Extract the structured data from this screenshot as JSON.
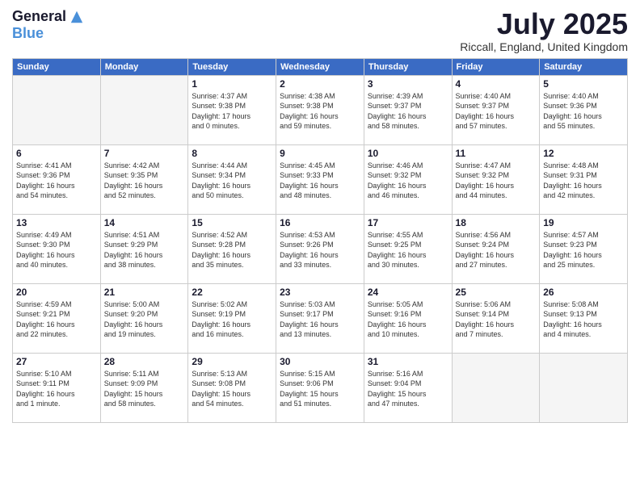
{
  "logo": {
    "general": "General",
    "blue": "Blue"
  },
  "header": {
    "title": "July 2025",
    "location": "Riccall, England, United Kingdom"
  },
  "weekdays": [
    "Sunday",
    "Monday",
    "Tuesday",
    "Wednesday",
    "Thursday",
    "Friday",
    "Saturday"
  ],
  "weeks": [
    [
      {
        "day": "",
        "info": ""
      },
      {
        "day": "",
        "info": ""
      },
      {
        "day": "1",
        "info": "Sunrise: 4:37 AM\nSunset: 9:38 PM\nDaylight: 17 hours\nand 0 minutes."
      },
      {
        "day": "2",
        "info": "Sunrise: 4:38 AM\nSunset: 9:38 PM\nDaylight: 16 hours\nand 59 minutes."
      },
      {
        "day": "3",
        "info": "Sunrise: 4:39 AM\nSunset: 9:37 PM\nDaylight: 16 hours\nand 58 minutes."
      },
      {
        "day": "4",
        "info": "Sunrise: 4:40 AM\nSunset: 9:37 PM\nDaylight: 16 hours\nand 57 minutes."
      },
      {
        "day": "5",
        "info": "Sunrise: 4:40 AM\nSunset: 9:36 PM\nDaylight: 16 hours\nand 55 minutes."
      }
    ],
    [
      {
        "day": "6",
        "info": "Sunrise: 4:41 AM\nSunset: 9:36 PM\nDaylight: 16 hours\nand 54 minutes."
      },
      {
        "day": "7",
        "info": "Sunrise: 4:42 AM\nSunset: 9:35 PM\nDaylight: 16 hours\nand 52 minutes."
      },
      {
        "day": "8",
        "info": "Sunrise: 4:44 AM\nSunset: 9:34 PM\nDaylight: 16 hours\nand 50 minutes."
      },
      {
        "day": "9",
        "info": "Sunrise: 4:45 AM\nSunset: 9:33 PM\nDaylight: 16 hours\nand 48 minutes."
      },
      {
        "day": "10",
        "info": "Sunrise: 4:46 AM\nSunset: 9:32 PM\nDaylight: 16 hours\nand 46 minutes."
      },
      {
        "day": "11",
        "info": "Sunrise: 4:47 AM\nSunset: 9:32 PM\nDaylight: 16 hours\nand 44 minutes."
      },
      {
        "day": "12",
        "info": "Sunrise: 4:48 AM\nSunset: 9:31 PM\nDaylight: 16 hours\nand 42 minutes."
      }
    ],
    [
      {
        "day": "13",
        "info": "Sunrise: 4:49 AM\nSunset: 9:30 PM\nDaylight: 16 hours\nand 40 minutes."
      },
      {
        "day": "14",
        "info": "Sunrise: 4:51 AM\nSunset: 9:29 PM\nDaylight: 16 hours\nand 38 minutes."
      },
      {
        "day": "15",
        "info": "Sunrise: 4:52 AM\nSunset: 9:28 PM\nDaylight: 16 hours\nand 35 minutes."
      },
      {
        "day": "16",
        "info": "Sunrise: 4:53 AM\nSunset: 9:26 PM\nDaylight: 16 hours\nand 33 minutes."
      },
      {
        "day": "17",
        "info": "Sunrise: 4:55 AM\nSunset: 9:25 PM\nDaylight: 16 hours\nand 30 minutes."
      },
      {
        "day": "18",
        "info": "Sunrise: 4:56 AM\nSunset: 9:24 PM\nDaylight: 16 hours\nand 27 minutes."
      },
      {
        "day": "19",
        "info": "Sunrise: 4:57 AM\nSunset: 9:23 PM\nDaylight: 16 hours\nand 25 minutes."
      }
    ],
    [
      {
        "day": "20",
        "info": "Sunrise: 4:59 AM\nSunset: 9:21 PM\nDaylight: 16 hours\nand 22 minutes."
      },
      {
        "day": "21",
        "info": "Sunrise: 5:00 AM\nSunset: 9:20 PM\nDaylight: 16 hours\nand 19 minutes."
      },
      {
        "day": "22",
        "info": "Sunrise: 5:02 AM\nSunset: 9:19 PM\nDaylight: 16 hours\nand 16 minutes."
      },
      {
        "day": "23",
        "info": "Sunrise: 5:03 AM\nSunset: 9:17 PM\nDaylight: 16 hours\nand 13 minutes."
      },
      {
        "day": "24",
        "info": "Sunrise: 5:05 AM\nSunset: 9:16 PM\nDaylight: 16 hours\nand 10 minutes."
      },
      {
        "day": "25",
        "info": "Sunrise: 5:06 AM\nSunset: 9:14 PM\nDaylight: 16 hours\nand 7 minutes."
      },
      {
        "day": "26",
        "info": "Sunrise: 5:08 AM\nSunset: 9:13 PM\nDaylight: 16 hours\nand 4 minutes."
      }
    ],
    [
      {
        "day": "27",
        "info": "Sunrise: 5:10 AM\nSunset: 9:11 PM\nDaylight: 16 hours\nand 1 minute."
      },
      {
        "day": "28",
        "info": "Sunrise: 5:11 AM\nSunset: 9:09 PM\nDaylight: 15 hours\nand 58 minutes."
      },
      {
        "day": "29",
        "info": "Sunrise: 5:13 AM\nSunset: 9:08 PM\nDaylight: 15 hours\nand 54 minutes."
      },
      {
        "day": "30",
        "info": "Sunrise: 5:15 AM\nSunset: 9:06 PM\nDaylight: 15 hours\nand 51 minutes."
      },
      {
        "day": "31",
        "info": "Sunrise: 5:16 AM\nSunset: 9:04 PM\nDaylight: 15 hours\nand 47 minutes."
      },
      {
        "day": "",
        "info": ""
      },
      {
        "day": "",
        "info": ""
      }
    ]
  ]
}
